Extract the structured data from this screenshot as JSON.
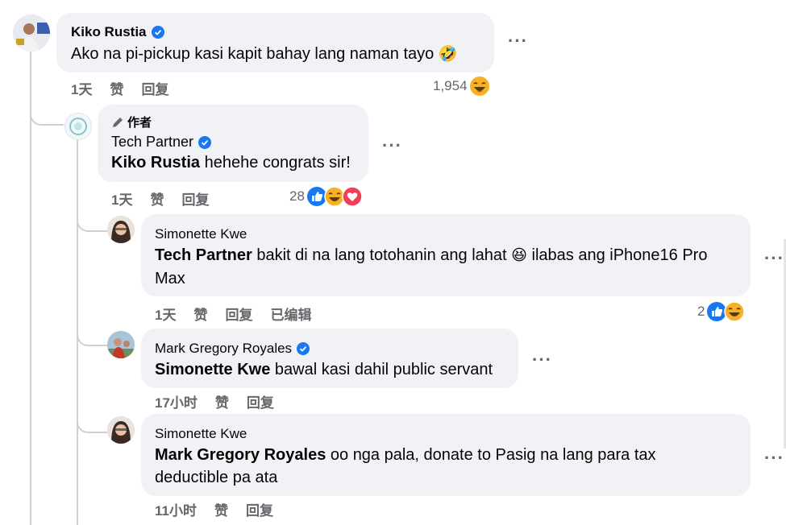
{
  "comments": [
    {
      "name": "Kiko Rustia",
      "text": "Ako na pi-pickup kasi kapit bahay lang naman tayo",
      "emoji": "🤣",
      "time": "1天",
      "like": "赞",
      "reply": "回复",
      "reactions": "1,954"
    },
    {
      "badge": "作者",
      "name": "Tech Partner",
      "mention": "Kiko Rustia",
      "text": " hehehe congrats sir!",
      "time": "1天",
      "like": "赞",
      "reply": "回复",
      "reactions": "28"
    },
    {
      "name": "Simonette Kwe",
      "mention": "Tech Partner",
      "text_a": " bakit di na lang totohanin ang lahat ",
      "emoji": "😆",
      "text_b": " ilabas ang iPhone16 Pro Max",
      "time": "1天",
      "like": "赞",
      "reply": "回复",
      "edited": "已编辑",
      "reactions": "2"
    },
    {
      "name": "Mark Gregory Royales",
      "mention": "Simonette Kwe",
      "text": " bawal kasi dahil public servant",
      "time": "17小时",
      "like": "赞",
      "reply": "回复"
    },
    {
      "name": "Simonette Kwe",
      "mention": "Mark Gregory Royales",
      "text": " oo nga pala, donate to Pasig na lang para tax deductible pa ata",
      "time": "11小时",
      "like": "赞",
      "reply": "回复"
    }
  ],
  "more_label": "···",
  "colors": {
    "bubble": "#f0f2f5",
    "meta": "#65676b",
    "verified": "#1877f2",
    "like": "#1877f2",
    "love": "#f33e58",
    "haha": "#f7b125"
  }
}
